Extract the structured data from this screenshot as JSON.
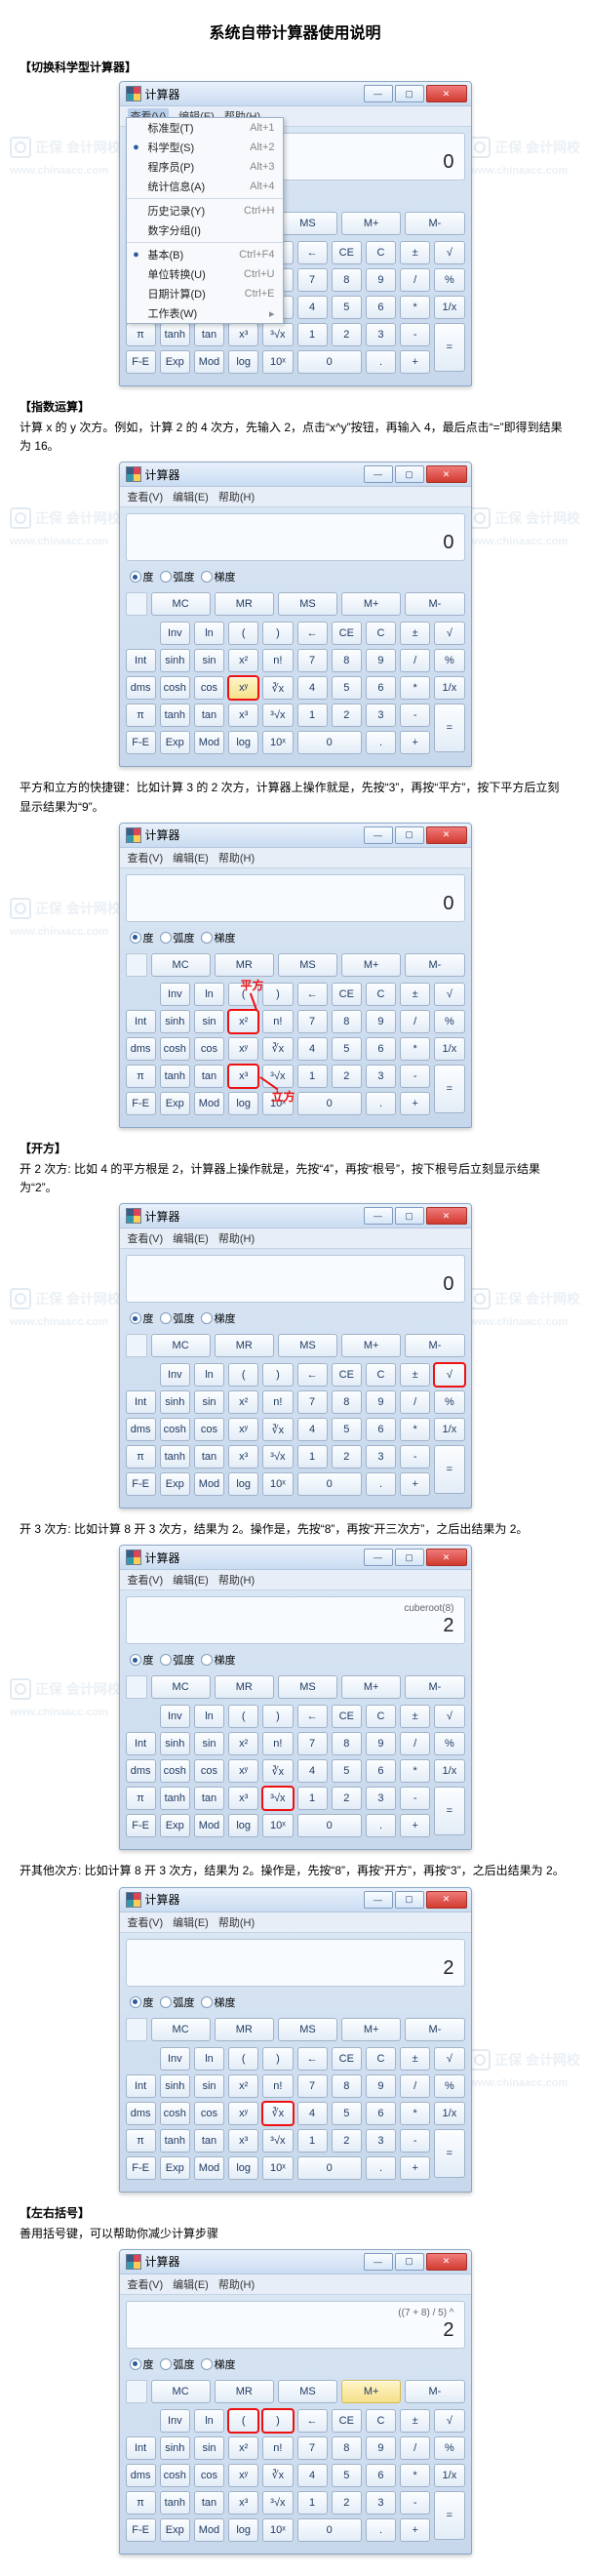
{
  "doc": {
    "title": "系统自带计算器使用说明"
  },
  "watermark": {
    "brand": "正保 会计网校",
    "url": "www.chinaacc.com"
  },
  "calc_common": {
    "app_title": "计算器",
    "menu": {
      "view": "查看(V)",
      "edit": "编辑(E)",
      "help": "帮助(H)"
    },
    "win_buttons": {
      "min": "—",
      "max": "▢",
      "close": "✕"
    },
    "angle": {
      "deg": "度",
      "rad": "弧度",
      "grad": "梯度"
    },
    "mem": [
      "MC",
      "MR",
      "MS",
      "M+",
      "M-"
    ],
    "row1": [
      "",
      "Inv",
      "ln",
      "(",
      ")",
      "←",
      "CE",
      "C",
      "±",
      "√"
    ],
    "row2": [
      "Int",
      "sinh",
      "sin",
      "x²",
      "n!",
      "7",
      "8",
      "9",
      "/",
      "%"
    ],
    "row3": [
      "dms",
      "cosh",
      "cos",
      "xʸ",
      "∛x",
      "4",
      "5",
      "6",
      "*",
      "1/x"
    ],
    "row4": [
      "π",
      "tanh",
      "tan",
      "x³",
      "³√x",
      "1",
      "2",
      "3",
      "-",
      "="
    ],
    "row5": [
      "F-E",
      "Exp",
      "Mod",
      "log",
      "10ˣ",
      "0",
      "",
      ".",
      "+",
      ""
    ]
  },
  "sections": [
    {
      "heading": "【切换科学型计算器】",
      "display_sub": "",
      "display": "0",
      "menu_items": [
        {
          "mark": "",
          "label": "标准型(T)",
          "accel": "Alt+1"
        },
        {
          "mark": "●",
          "label": "科学型(S)",
          "accel": "Alt+2"
        },
        {
          "mark": "",
          "label": "程序员(P)",
          "accel": "Alt+3"
        },
        {
          "mark": "",
          "label": "统计信息(A)",
          "accel": "Alt+4"
        },
        {
          "sep": true
        },
        {
          "mark": "",
          "label": "历史记录(Y)",
          "accel": "Ctrl+H"
        },
        {
          "mark": "",
          "label": "数字分组(I)",
          "accel": ""
        },
        {
          "sep": true
        },
        {
          "mark": "●",
          "label": "基本(B)",
          "accel": "Ctrl+F4"
        },
        {
          "mark": "",
          "label": "单位转换(U)",
          "accel": "Ctrl+U"
        },
        {
          "mark": "",
          "label": "日期计算(D)",
          "accel": "Ctrl+E"
        },
        {
          "mark": "",
          "label": "工作表(W)",
          "accel": "▸"
        }
      ]
    },
    {
      "heading": "【指数运算】",
      "desc": "计算 x 的 y 次方。例如，计算 2 的 4 次方，先输入 2，点击“x^y”按钮，再输入 4，最后点击“=”即得到结果为 16。",
      "display_sub": "",
      "display": "0",
      "highlight": "xʸ-red"
    },
    {
      "desc": "平方和立方的快捷键：比如计算 3 的 2 次方，计算器上操作就是，先按“3”，再按“平方”，按下平方后立刻显示结果为“9”。",
      "display_sub": "",
      "display": "0",
      "highlight": "sq-cube",
      "anno_sq": "平方",
      "anno_cube": "立方"
    },
    {
      "heading": "【开方】",
      "desc": "开 2 次方: 比如 4 的平方根是 2，计算器上操作就是，先按“4”，再按“根号”，按下根号后立刻显示结果为“2”。",
      "display_sub": "",
      "display": "0",
      "highlight": "sqrt"
    },
    {
      "desc": "开 3 次方: 比如计算 8 开 3 次方，结果为 2。操作是，先按“8”，再按“开三次方”，之后出结果为 2。",
      "display_sub": "cuberoot(8)",
      "display": "2",
      "highlight": "cbrt"
    },
    {
      "desc": "开其他次方: 比如计算 8 开 3 次方，结果为 2。操作是，先按“8”，再按“开方”，再按“3”，之后出结果为 2。",
      "display_sub": "",
      "display": "2",
      "highlight": "yroot"
    },
    {
      "heading": "【左右括号】",
      "desc": "善用括号键，可以帮助你减少计算步骤",
      "display_sub": "((7 + 8) / 5) ^",
      "display": "2",
      "highlight": "parens"
    }
  ]
}
